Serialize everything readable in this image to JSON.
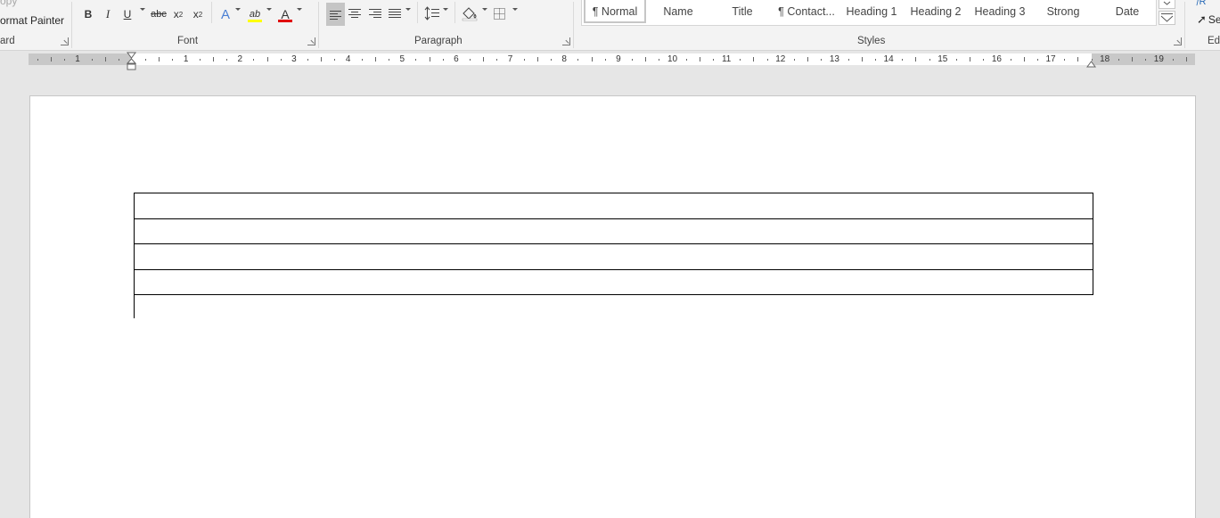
{
  "ribbon": {
    "clipboard": {
      "copy_label": "opy",
      "format_painter_label": "ormat Painter",
      "group_label": "ard"
    },
    "font": {
      "group_label": "Font",
      "bold": "B",
      "italic": "I",
      "underline": "U",
      "strikethrough": "abc",
      "subscript_base": "x",
      "subscript_mark": "2",
      "superscript_base": "x",
      "superscript_mark": "2",
      "text_effects": "A",
      "highlight": "ab",
      "font_color": "A",
      "highlight_color": "#ffff00",
      "font_color_bar": "#e00000"
    },
    "paragraph": {
      "group_label": "Paragraph"
    },
    "styles": {
      "group_label": "Styles",
      "items": [
        "¶ Normal",
        "Name",
        "Title",
        "¶ Contact...",
        "Heading 1",
        "Heading 2",
        "Heading 3",
        "Strong",
        "Date"
      ]
    },
    "editing": {
      "group_label": "Edi",
      "replace_label": "R",
      "select_label": "Se"
    }
  },
  "ruler": {
    "left_numbers": [
      "1"
    ],
    "numbers": [
      "1",
      "2",
      "3",
      "4",
      "5",
      "6",
      "7",
      "8",
      "9",
      "10",
      "11",
      "12",
      "13",
      "14",
      "15",
      "16",
      "17",
      "18",
      "19"
    ]
  },
  "document": {
    "table_rows": 4
  }
}
